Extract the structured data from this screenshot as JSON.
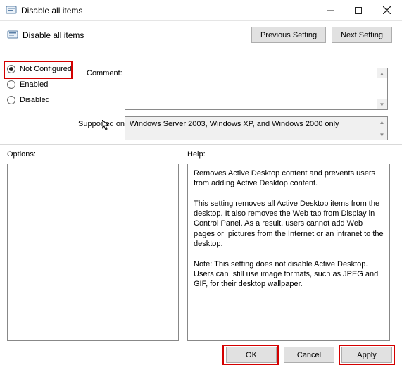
{
  "window": {
    "title": "Disable all items",
    "subtitle": "Disable all items"
  },
  "nav": {
    "previous": "Previous Setting",
    "next": "Next Setting"
  },
  "settings": {
    "options": [
      "Not Configured",
      "Enabled",
      "Disabled"
    ],
    "selected_index": 0
  },
  "labels": {
    "comment": "Comment:",
    "supported": "Supported on:",
    "options": "Options:",
    "help": "Help:"
  },
  "fields": {
    "comment_value": "",
    "supported_value": "Windows Server 2003, Windows XP, and Windows 2000 only"
  },
  "help_text": "Removes Active Desktop content and prevents users from adding Active Desktop content.\n\nThis setting removes all Active Desktop items from the desktop. It also removes the Web tab from Display in Control Panel. As a result, users cannot add Web pages or  pictures from the Internet or an intranet to the desktop.\n\nNote: This setting does not disable Active Desktop. Users can  still use image formats, such as JPEG and GIF, for their desktop wallpaper.",
  "buttons": {
    "ok": "OK",
    "cancel": "Cancel",
    "apply": "Apply"
  },
  "highlights": {
    "note": "red outlines visible on Not Configured radio, OK button, Apply button"
  }
}
